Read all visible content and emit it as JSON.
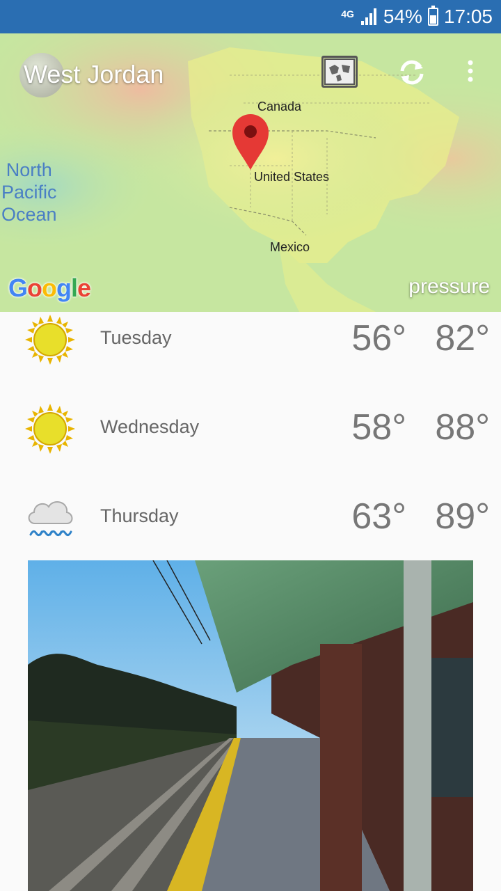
{
  "status_bar": {
    "network": "4G",
    "battery": "54%",
    "time": "17:05"
  },
  "map": {
    "city": "West Jordan",
    "labels": {
      "canada": "Canada",
      "united_states": "United States",
      "mexico": "Mexico",
      "ocean": [
        "North",
        "Pacific",
        "Ocean"
      ]
    },
    "layer": "pressure",
    "icons": [
      "map-layers-icon",
      "refresh-icon",
      "overflow-menu-icon",
      "location-pin-icon"
    ]
  },
  "forecast": [
    {
      "day": "Tuesday",
      "icon": "sunny-icon",
      "low": "56°",
      "high": "82°"
    },
    {
      "day": "Wednesday",
      "icon": "sunny-icon",
      "low": "58°",
      "high": "88°"
    },
    {
      "day": "Thursday",
      "icon": "rain-icon",
      "low": "63°",
      "high": "89°"
    }
  ],
  "colors": {
    "status_bar": "#2a6eb2",
    "pin": "#e53935",
    "text": "#777777"
  }
}
